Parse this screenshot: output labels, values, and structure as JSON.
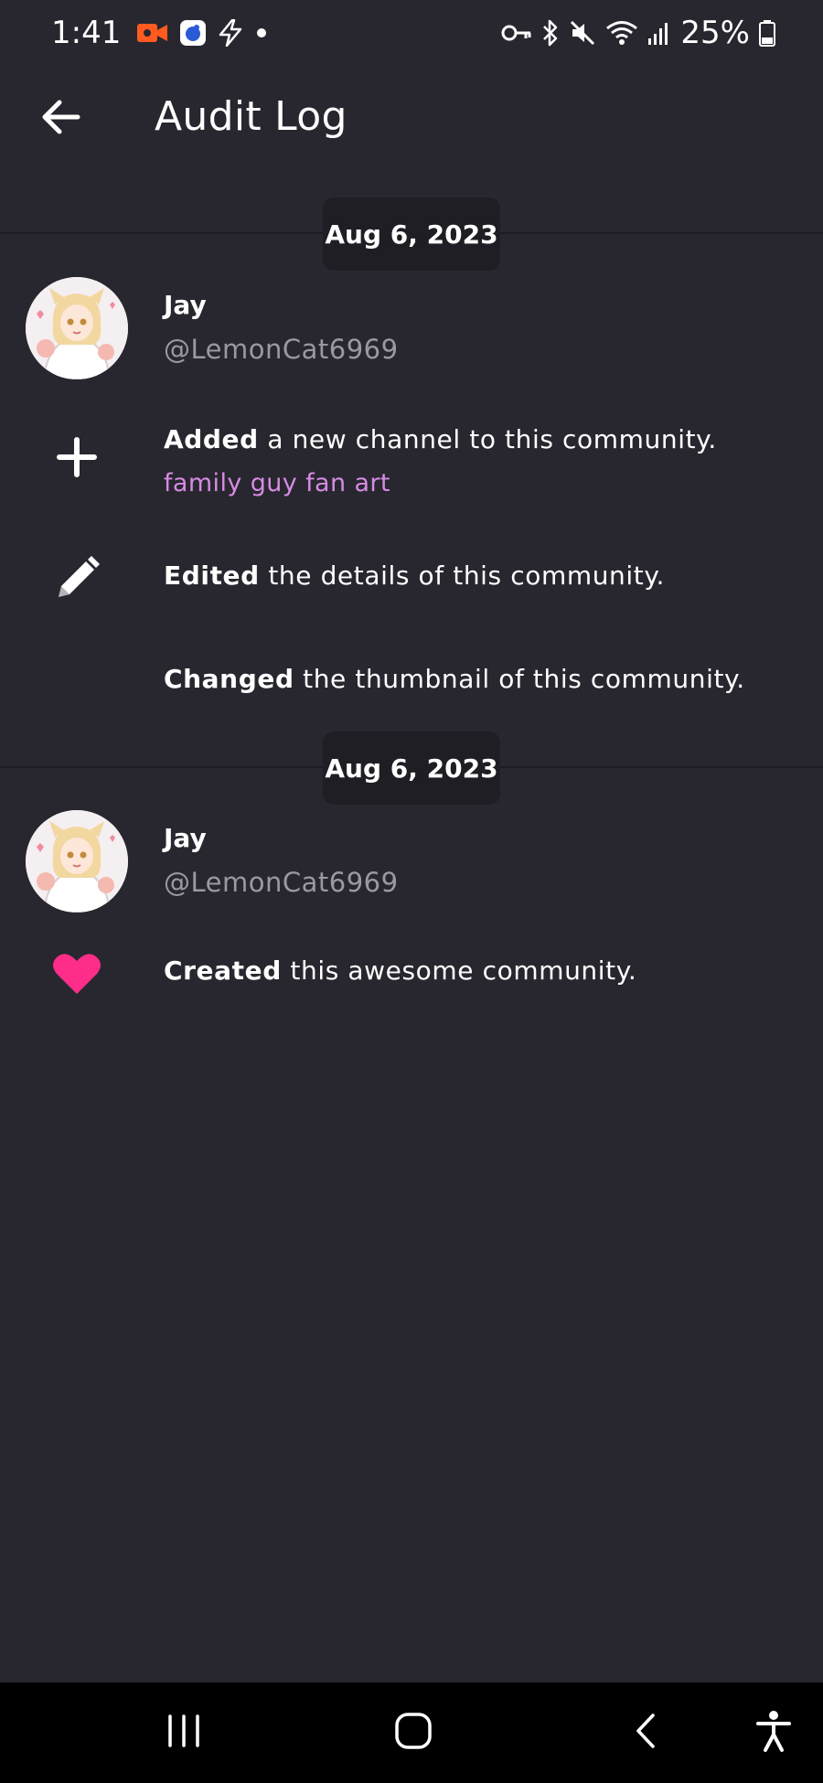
{
  "status_bar": {
    "time": "1:41",
    "battery": "25%",
    "left_icons": [
      "video-record-icon",
      "app-notification-icon",
      "bolt-icon",
      "dot-icon"
    ],
    "right_icons": [
      "vpn-key-icon",
      "bluetooth-icon",
      "mute-icon",
      "wifi-icon",
      "signal-icon",
      "battery-icon"
    ]
  },
  "header": {
    "title": "Audit Log",
    "back_icon": "arrow-left-icon"
  },
  "groups": [
    {
      "date": "Aug 6, 2023",
      "user": {
        "name": "Jay",
        "handle": "@LemonCat6969"
      },
      "entries": [
        {
          "icon": "plus-icon",
          "action": "Added",
          "text": "a new channel to this community.",
          "link": "family guy fan art"
        },
        {
          "icon": "pencil-icon",
          "action": "Edited",
          "text": "the details of this community."
        },
        {
          "icon": "",
          "action": "Changed",
          "text": "the thumbnail of this community."
        }
      ]
    },
    {
      "date": "Aug 6, 2023",
      "user": {
        "name": "Jay",
        "handle": "@LemonCat6969"
      },
      "entries": [
        {
          "icon": "heart-icon",
          "action": "Created",
          "text": "this awesome community."
        }
      ]
    }
  ],
  "colors": {
    "background": "#28272f",
    "date_pill": "#1f1e25",
    "link": "#d68be4",
    "heart": "#ff2d8a",
    "handle": "#9a99a3",
    "recording": "#ff5a1f"
  },
  "nav_bar": {
    "buttons": [
      "recents-icon",
      "home-icon",
      "back-icon",
      "accessibility-icon"
    ]
  }
}
